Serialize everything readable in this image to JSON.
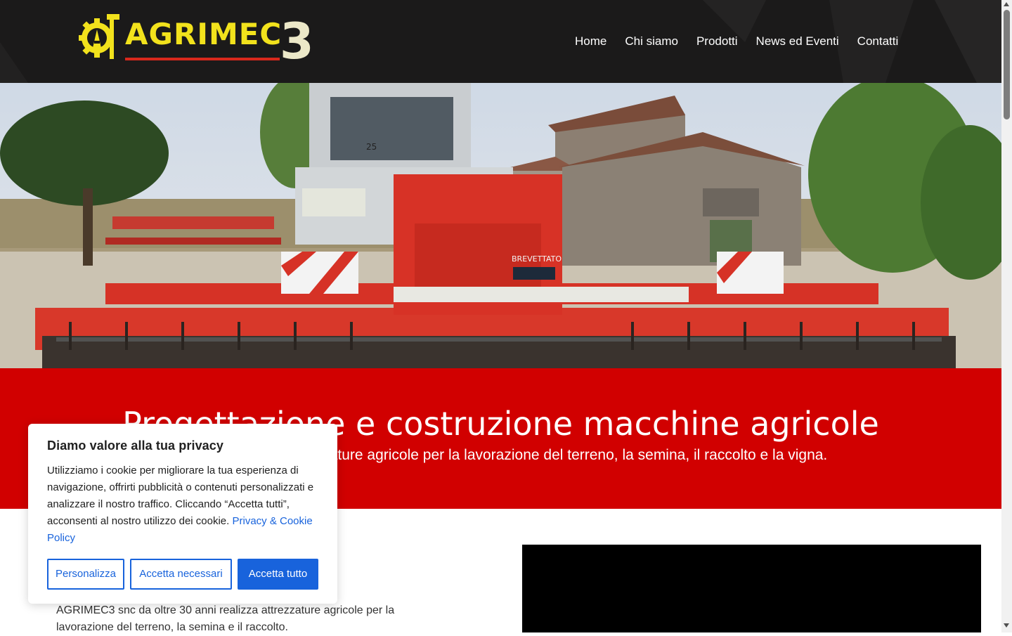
{
  "brand": {
    "name": "AGRIMEC",
    "number": "3"
  },
  "nav": {
    "items": [
      {
        "label": "Home"
      },
      {
        "label": "Chi siamo"
      },
      {
        "label": "Prodotti"
      },
      {
        "label": "News ed Eventi"
      },
      {
        "label": "Contatti"
      }
    ]
  },
  "hero": {
    "machine_label": "BREVETTATO",
    "plate_text": "25"
  },
  "banner": {
    "title": "Progettazione e costruzione macchine agricole",
    "subtitle": "zzature agricole per la lavorazione del terreno, la semina, il raccolto e la vigna."
  },
  "intro": {
    "text": "AGRIMEC3 snc da oltre 30 anni realizza attrezzature agricole per la lavorazione del terreno, la semina e il raccolto."
  },
  "cookie": {
    "title": "Diamo valore alla tua privacy",
    "body": "Utilizziamo i cookie per migliorare la tua esperienza di navigazione, offrirti pubblicità o contenuti personalizzati e analizzare il nostro traffico. Cliccando “Accetta tutti”, acconsenti al nostro utilizzo dei cookie. ",
    "link": "Privacy & Cookie Policy",
    "buttons": {
      "customize": "Personalizza",
      "necessary": "Accetta necessari",
      "accept_all": "Accetta tutto"
    }
  },
  "colors": {
    "header_bg": "#1b1a1a",
    "banner_red": "#d10000",
    "logo_yellow": "#f2e21c",
    "cookie_blue": "#1863dc"
  }
}
